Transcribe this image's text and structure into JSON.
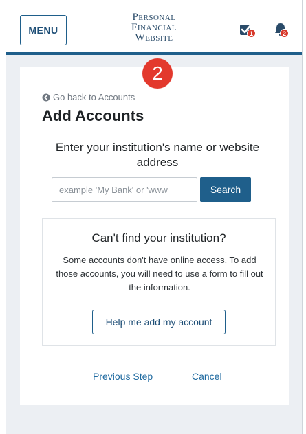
{
  "header": {
    "menu_label": "MENU",
    "brand_line1": "Personal",
    "brand_line2": "Financial",
    "brand_line3": "Website",
    "tasks_badge": "1",
    "notifications_badge": "2"
  },
  "step_marker": "2",
  "page": {
    "back_link": "Go back to Accounts",
    "title": "Add Accounts",
    "prompt": "Enter your institution's name or website address"
  },
  "search": {
    "placeholder": "example 'My Bank' or 'www",
    "value": "",
    "button_label": "Search"
  },
  "help_box": {
    "title": "Can't find your institution?",
    "text": "Some accounts don't have online access. To add those accounts, you will need to use a form to fill out the information.",
    "button_label": "Help me add my account"
  },
  "footer": {
    "previous_label": "Previous Step",
    "cancel_label": "Cancel"
  },
  "colors": {
    "primary": "#1f5f8b",
    "badge": "#d8392b",
    "step_marker": "#e3392d",
    "page_background": "#eceff3"
  },
  "icons": {
    "tasks": "checkbox-icon",
    "notifications": "bell-icon",
    "back": "circle-arrow-left-icon"
  }
}
